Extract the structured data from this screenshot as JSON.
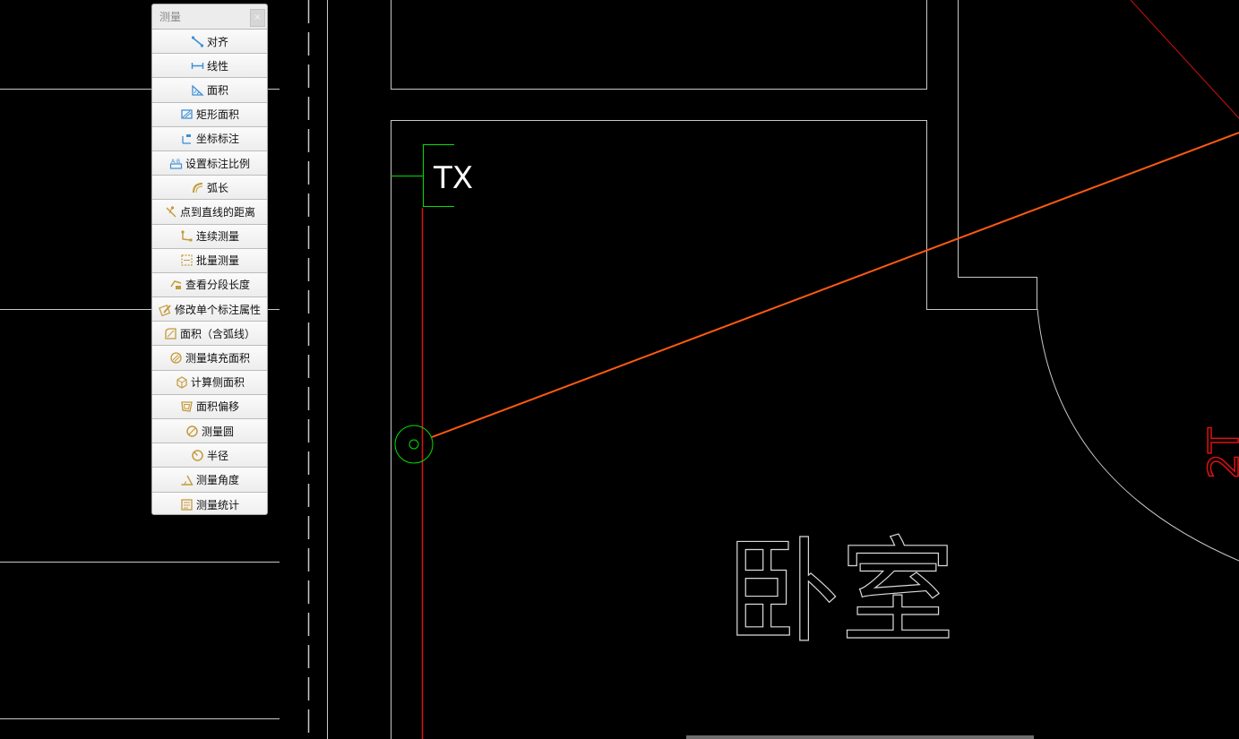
{
  "colors": {
    "background": "#000000",
    "wall_line": "#c8c8c8",
    "axis_red": "#e01010",
    "measure_orange": "#ff5a10",
    "marker_green": "#00e000",
    "text_white": "#ffffff",
    "icon_blue": "#3c8fd6",
    "icon_gold": "#c49a3a"
  },
  "panel": {
    "title": "测量",
    "close_label": "×",
    "items": [
      {
        "label": "对齐",
        "icon": "aligned-dimension-icon"
      },
      {
        "label": "线性",
        "icon": "linear-dimension-icon"
      },
      {
        "label": "面积",
        "icon": "area-icon"
      },
      {
        "label": "矩形面积",
        "icon": "rectangle-area-icon"
      },
      {
        "label": "坐标标注",
        "icon": "coordinate-dimension-icon"
      },
      {
        "label": "设置标注比例",
        "icon": "dimension-scale-icon"
      },
      {
        "label": "弧长",
        "icon": "arc-length-icon"
      },
      {
        "label": "点到直线的距离",
        "icon": "point-to-line-icon"
      },
      {
        "label": "连续测量",
        "icon": "continuous-measure-icon"
      },
      {
        "label": "批量测量",
        "icon": "batch-measure-icon"
      },
      {
        "label": "查看分段长度",
        "icon": "segment-length-icon"
      },
      {
        "label": "修改单个标注属性",
        "icon": "edit-dimension-icon"
      },
      {
        "label": "面积（含弧线）",
        "icon": "arc-area-icon"
      },
      {
        "label": "测量填充面积",
        "icon": "hatch-area-icon"
      },
      {
        "label": "计算侧面积",
        "icon": "side-area-icon"
      },
      {
        "label": "面积偏移",
        "icon": "area-offset-icon"
      },
      {
        "label": "测量圆",
        "icon": "measure-circle-icon"
      },
      {
        "label": "半径",
        "icon": "radius-icon"
      },
      {
        "label": "测量角度",
        "icon": "measure-angle-icon"
      },
      {
        "label": "测量统计",
        "icon": "measure-statistics-icon"
      }
    ]
  },
  "drawing": {
    "tag_label": "TX",
    "room_label": "卧室",
    "dimension_label": "2T"
  }
}
